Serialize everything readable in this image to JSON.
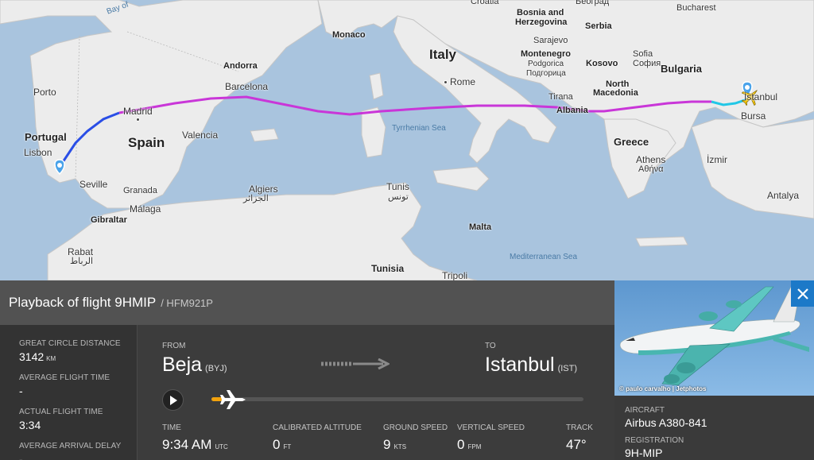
{
  "map": {
    "labels": {
      "bay_of_biscay": "Bay of",
      "croatia": "Croatia",
      "beograd": "Београд",
      "bucharest": "Bucharest",
      "bosnia": "Bosnia and",
      "herzegovina": "Herzegovina",
      "serbia": "Serbia",
      "sarajevo": "Sarajevo",
      "montenegro": "Montenegro",
      "sofia": "Sofia",
      "sofia_cyr": "София",
      "podgorica": "Podgorica",
      "podgorica_cyr": "Подгорица",
      "kosovo": "Kosovo",
      "bulgaria": "Bulgaria",
      "monaco": "Monaco",
      "italy": "Italy",
      "andorra": "Andorra",
      "barcelona": "Barcelona",
      "rome": "Rome",
      "tirana": "Tirana",
      "north": "North",
      "macedonia": "Macedonia",
      "istanbul": "İstanbul",
      "albania": "Albania",
      "bursa": "Bursa",
      "porto": "Porto",
      "madrid": "Madrid",
      "portugal": "Portugal",
      "spain": "Spain",
      "valencia": "Valencia",
      "lisbon": "Lisbon",
      "tyrrhenian": "Tyrrhenian Sea",
      "greece": "Greece",
      "athens": "Athens",
      "athens_gr": "Αθήνα",
      "izmir": "İzmir",
      "seville": "Seville",
      "granada": "Granada",
      "malaga": "Málaga",
      "algiers": "Algiers",
      "algiers_ar": "الجزائر",
      "tunis": "Tunis",
      "tunis_ar": "تونس",
      "gibraltar": "Gibraltar",
      "antalya": "Antalya",
      "malta": "Malta",
      "rabat": "Rabat",
      "rabat_ar": "الرباط",
      "mediterranean": "Mediterranean Sea",
      "tunisia": "Tunisia",
      "tripoli": "Tripoli",
      "croatia_top": "Croatia"
    },
    "colors": {
      "water": "#a9c4de",
      "land": "#eeeeee",
      "track_low": "#2a4ee6",
      "track_high": "#c936d8",
      "track_descent": "#22c7e6"
    }
  },
  "panel": {
    "title": "Playback of flight 9HMIP",
    "callsign": "/ HFM921P",
    "stats": [
      {
        "label": "GREAT CIRCLE DISTANCE",
        "value": "3142",
        "unit": "KM"
      },
      {
        "label": "AVERAGE FLIGHT TIME",
        "value": "-",
        "unit": ""
      },
      {
        "label": "ACTUAL FLIGHT TIME",
        "value": "3:34",
        "unit": ""
      },
      {
        "label": "AVERAGE ARRIVAL DELAY",
        "value": "-",
        "unit": ""
      }
    ],
    "from": {
      "label": "FROM",
      "name": "Beja",
      "code": "(BYJ)"
    },
    "to": {
      "label": "TO",
      "name": "Istanbul",
      "code": "(IST)"
    },
    "playback_progress": 0.03,
    "metrics": [
      {
        "label": "TIME",
        "value": "9:34 AM",
        "unit": "UTC"
      },
      {
        "label": "CALIBRATED ALTITUDE",
        "value": "0",
        "unit": "FT"
      },
      {
        "label": "GROUND SPEED",
        "value": "9",
        "unit": "KTS"
      },
      {
        "label": "VERTICAL SPEED",
        "value": "0",
        "unit": "FPM"
      },
      {
        "label": "TRACK",
        "value": "47°",
        "unit": ""
      }
    ],
    "accent": "#f2a20d"
  },
  "card": {
    "photo_credit": "© paulo carvalho | Jetphotos",
    "aircraft_label": "AIRCRAFT",
    "aircraft_value": "Airbus A380-841",
    "registration_label": "REGISTRATION",
    "registration_value": "9H-MIP",
    "close_icon": "close-icon"
  }
}
